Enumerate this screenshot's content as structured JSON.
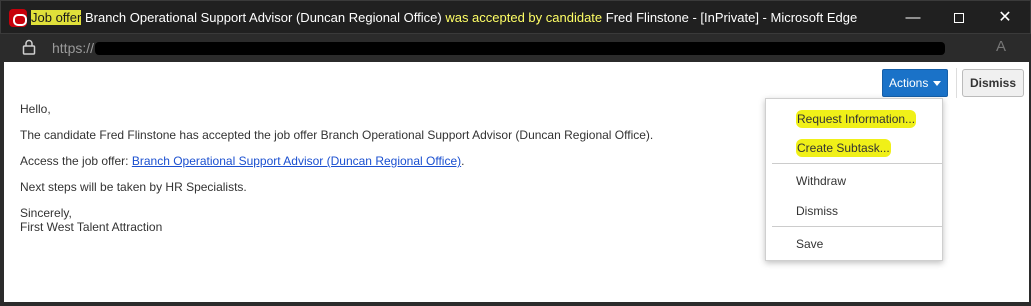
{
  "window": {
    "title_hl1": "Job offer",
    "title_part1": " Branch Operational Support Advisor (Duncan Regional Office) ",
    "title_hl2": "was accepted by candidate",
    "title_part2": " Fred Flinstone - [InPrivate] - Microsoft Edge",
    "minimize": "—",
    "close": "✕"
  },
  "addressbar": {
    "url_prefix": "https://",
    "read_aloud": "A"
  },
  "toolbar": {
    "actions_label": "Actions",
    "dismiss_label": "Dismiss"
  },
  "actions_menu": {
    "items": [
      {
        "label": "Request Information..."
      },
      {
        "label": "Create Subtask..."
      },
      {
        "label": "Withdraw"
      },
      {
        "label": "Dismiss"
      },
      {
        "label": "Save"
      }
    ]
  },
  "email": {
    "greeting": "Hello,",
    "body_line1": "The candidate Fred Flinstone has accepted the job offer Branch Operational Support Advisor (Duncan Regional Office).",
    "access_prefix": "Access the job offer: ",
    "access_link": "Branch Operational Support Advisor (Duncan Regional Office)",
    "access_suffix": ".",
    "next_steps": "Next steps will be taken by HR Specialists.",
    "signoff": "Sincerely,",
    "signature": "First West Talent Attraction"
  },
  "colors": {
    "accent": "#1a72c8",
    "highlight": "#f0f018",
    "titlebar": "#202020"
  },
  "icons": [
    "oracle-app-icon",
    "lock-icon",
    "read-aloud-icon",
    "caret-down-icon"
  ]
}
